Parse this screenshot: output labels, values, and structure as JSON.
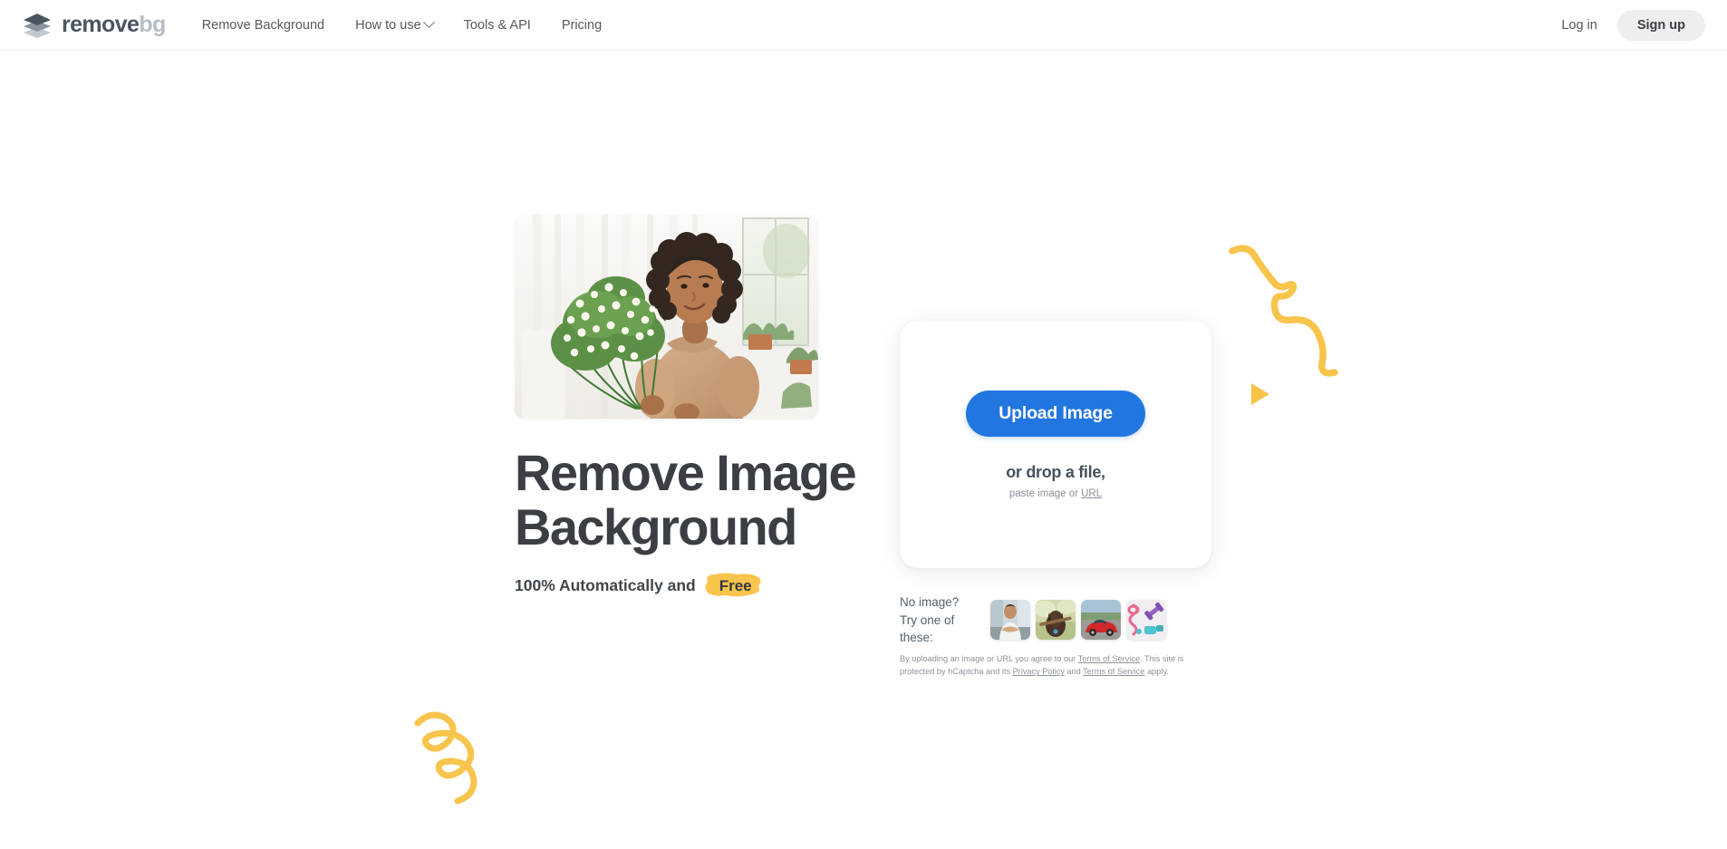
{
  "colors": {
    "accent_blue": "#2276e0",
    "accent_yellow": "#f7c44c",
    "text_dark": "#3b3f43",
    "text_muted": "#8a9099",
    "logo_dark": "#4b5560",
    "logo_light": "#b7bdc4",
    "signup_bg": "#eceef0"
  },
  "header": {
    "logo": {
      "icon": "layers-stack-icon",
      "text_primary": "remove",
      "text_secondary": "bg"
    },
    "nav": [
      {
        "label": "Remove Background",
        "has_dropdown": false,
        "name": "nav-remove-background"
      },
      {
        "label": "How to use",
        "has_dropdown": true,
        "name": "nav-how-to-use"
      },
      {
        "label": "Tools & API",
        "has_dropdown": false,
        "name": "nav-tools-api"
      },
      {
        "label": "Pricing",
        "has_dropdown": false,
        "name": "nav-pricing"
      }
    ],
    "login_label": "Log in",
    "signup_label": "Sign up"
  },
  "hero": {
    "photo_alt": "Smiling woman with curly hair holding a bouquet of white flowers in a bright room",
    "title_line1": "Remove Image",
    "title_line2": "Background",
    "subtitle_prefix": "100% Automatically and",
    "subtitle_badge": "Free"
  },
  "upload": {
    "button_label": "Upload Image",
    "drop_text": "or drop a file,",
    "paste_prefix": "paste image or ",
    "paste_link": "URL"
  },
  "samples": {
    "label_line1": "No image?",
    "label_line2": "Try one of these:",
    "items": [
      {
        "alt": "Man sitting with arms crossed outdoors",
        "name": "sample-thumbnail-man"
      },
      {
        "alt": "Brown dog carrying a stick in a field",
        "name": "sample-thumbnail-dog"
      },
      {
        "alt": "Red sports car on a road",
        "name": "sample-thumbnail-car"
      },
      {
        "alt": "Fitness equipment flat lay with dumbbells and resistance band",
        "name": "sample-thumbnail-fitness"
      }
    ]
  },
  "legal": {
    "part1": "By uploading an image or URL you agree to our ",
    "link1": "Terms of Service",
    "part2": ". This site is protected by hCaptcha and its ",
    "link2": "Privacy Policy",
    "part3": " and ",
    "link3": "Terms of Service",
    "part4": " apply."
  },
  "decor": {
    "squiggle_right": "yellow-squiggle-with-loop",
    "triangle": "yellow-play-triangle",
    "squiggle_left": "yellow-spiral-squiggle"
  }
}
